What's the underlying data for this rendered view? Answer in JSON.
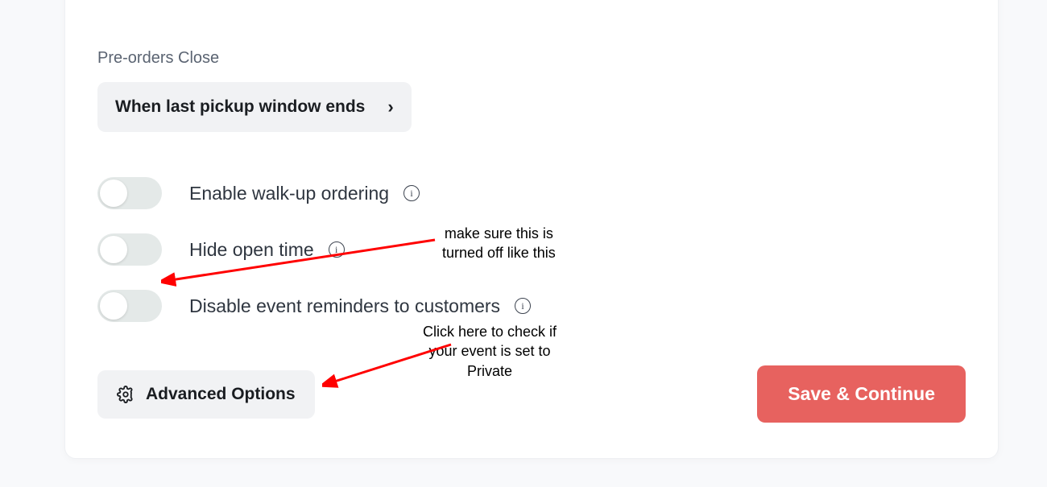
{
  "preorders": {
    "label": "Pre-orders Close",
    "value": "When last pickup window ends"
  },
  "toggles": {
    "walkup": {
      "label": "Enable walk-up ordering",
      "on": false
    },
    "hide_open": {
      "label": "Hide open time",
      "on": false
    },
    "disable_reminders": {
      "label": "Disable event reminders to customers",
      "on": false
    }
  },
  "advanced_label": "Advanced Options",
  "save_label": "Save & Continue",
  "annotations": {
    "a1": "make sure this is\nturned off like this",
    "a2": "Click here to check if\nyour event is set to\nPrivate"
  }
}
